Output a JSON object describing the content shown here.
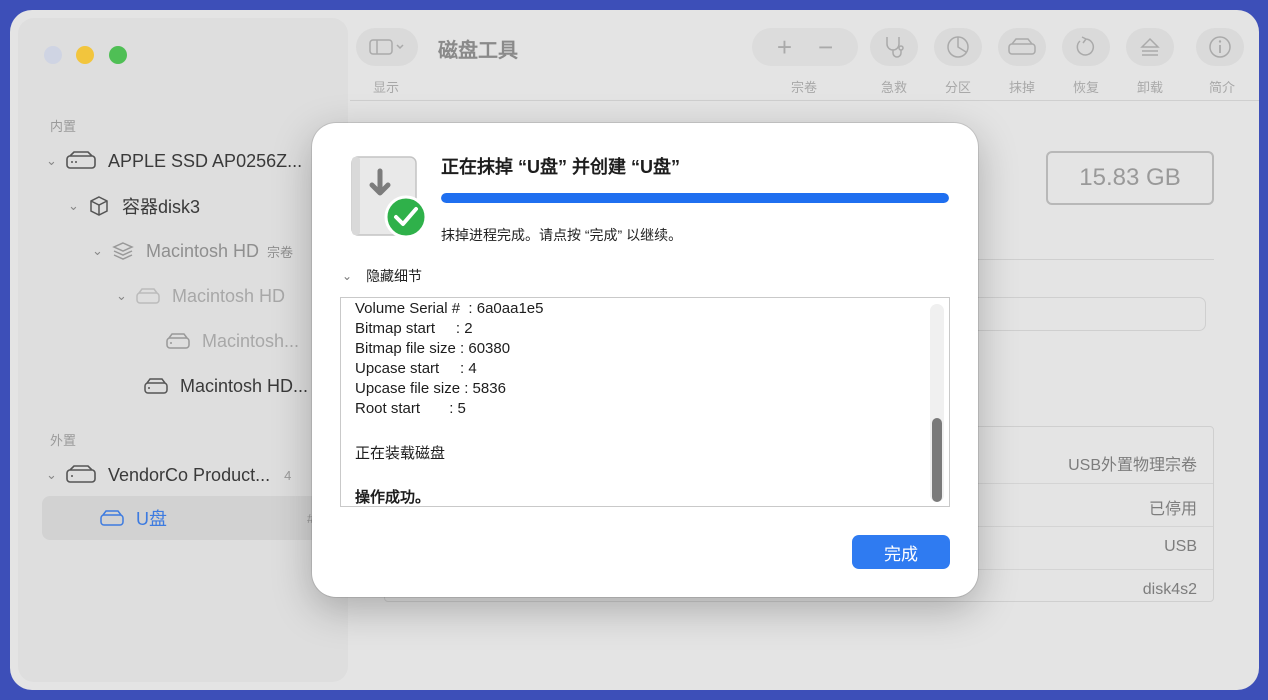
{
  "window": {
    "title": "磁盘工具"
  },
  "sidebar": {
    "section_internal": "内置",
    "section_external": "外置",
    "items": [
      {
        "label": "APPLE SSD AP0256Z...",
        "icon": "internal-drive-icon"
      },
      {
        "label": "容器disk3",
        "icon": "container-icon"
      },
      {
        "label": "Macintosh HD",
        "suffix": "宗卷",
        "icon": "volume-stack-icon"
      },
      {
        "label": "Macintosh HD",
        "icon": "disk-icon"
      },
      {
        "label": "Macintosh...",
        "icon": "disk-icon"
      },
      {
        "label": "Macintosh HD...",
        "icon": "disk-icon"
      },
      {
        "label": "VendorCo Product...",
        "suffix": "4",
        "icon": "external-drive-icon"
      },
      {
        "label": "U盘",
        "suffix": "#",
        "icon": "usb-drive-icon"
      }
    ]
  },
  "toolbar": {
    "view_label": "显示",
    "volume_label": "宗卷",
    "firstaid_label": "急救",
    "partition_label": "分区",
    "erase_label": "抹掉",
    "restore_label": "恢复",
    "unmount_label": "卸载",
    "info_label": "简介"
  },
  "main": {
    "capacity": "15.83 GB",
    "info_rows": [
      "USB外置物理宗卷",
      "已停用",
      "USB",
      "disk4s2"
    ]
  },
  "dialog": {
    "title": "正在抹掉 “U盘” 并创建 “U盘”",
    "progress": 1.0,
    "status": "抹掉进程完成。请点按 “完成” 以继续。",
    "details_toggle": "隐藏细节",
    "log": [
      "Volume Serial #  : 6a0aa1e5",
      "Bitmap start     : 2",
      "Bitmap file size : 60380",
      "Upcase start     : 4",
      "Upcase file size : 5836",
      "Root start       : 5",
      "正在装载磁盘",
      "操作成功。"
    ],
    "done_label": "完成"
  },
  "colors": {
    "accent": "#2f7bf1",
    "success": "#2fb14a"
  }
}
